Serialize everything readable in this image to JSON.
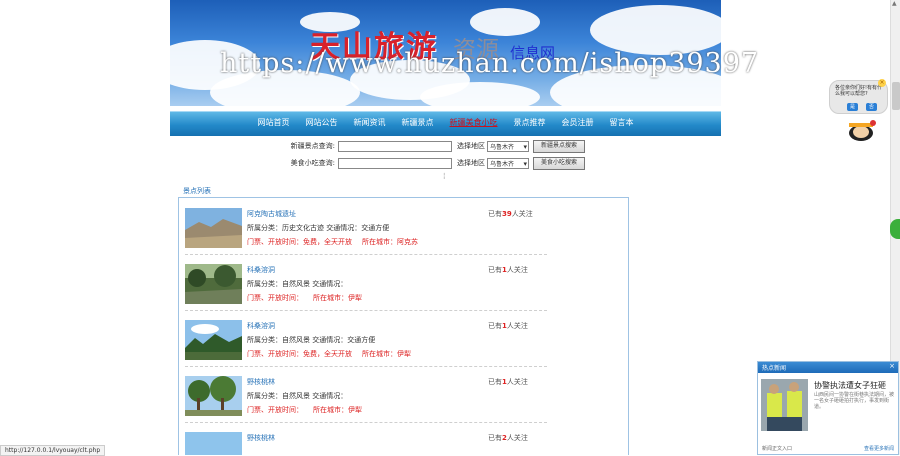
{
  "banner": {
    "logo_red": "天山旅游",
    "logo_grey": "资源",
    "logo_blue": "信息网",
    "watermark": "https://www.huzhan.com/ishop39397"
  },
  "nav": {
    "items": [
      {
        "label": "网站首页"
      },
      {
        "label": "网站公告"
      },
      {
        "label": "新闻资讯"
      },
      {
        "label": "新疆景点"
      },
      {
        "label": "新疆美食小吃"
      },
      {
        "label": "景点推荐"
      },
      {
        "label": "会员注册"
      },
      {
        "label": "留言本"
      }
    ],
    "active_index": 4
  },
  "search": {
    "scenic": {
      "label": "新疆景点查询:",
      "region_label": "选择地区",
      "region_value": "乌鲁木齐",
      "button": "新疆景点搜索"
    },
    "food": {
      "label": "美食小吃查询:",
      "region_label": "选择地区",
      "region_value": "乌鲁木齐",
      "button": "美食小吃搜索"
    }
  },
  "list": {
    "header": "景点列表",
    "items": [
      {
        "name": "阿克陶古城遗址",
        "meta": "所属分类：历史文化古迹  交通情况：交通方便",
        "ticket": "门票、开放时间：免费，全天开放",
        "city": "所在城市：阿克苏",
        "follow_prefix": "已有",
        "follow_count": "39",
        "follow_suffix": "人关注"
      },
      {
        "name": "科桑溶洞",
        "meta": "所属分类：自然风景  交通情况：",
        "ticket": "门票、开放时间：",
        "city": "所在城市：伊犁",
        "follow_prefix": "已有",
        "follow_count": "1",
        "follow_suffix": "人关注"
      },
      {
        "name": "科桑溶洞",
        "meta": "所属分类：自然风景  交通情况：交通方便",
        "ticket": "门票、开放时间：免费，全天开放",
        "city": "所在城市：伊犁",
        "follow_prefix": "已有",
        "follow_count": "1",
        "follow_suffix": "人关注"
      },
      {
        "name": "野核桃林",
        "meta": "所属分类：自然风景  交通情况：",
        "ticket": "门票、开放时间：",
        "city": "所在城市：伊犁",
        "follow_prefix": "已有",
        "follow_count": "1",
        "follow_suffix": "人关注"
      },
      {
        "name": "野核桃林",
        "meta": "",
        "ticket": "",
        "city": "",
        "follow_prefix": "已有",
        "follow_count": "2",
        "follow_suffix": "人关注"
      }
    ]
  },
  "chat_widget": {
    "bubble_text": "各位亲你们好!有有什么我可以帮您?",
    "yes_label": "是",
    "no_label": "否"
  },
  "news_popup": {
    "title": "热点新闻",
    "close": "×",
    "headline": "协警执法遭女子狂砸",
    "summary": "山西民间一协警在街巷执法期间，被一名女子砸砸拍打执行，事发到街道。",
    "footer_left": "新闻正文入口",
    "footer_right": "查看更多新闻"
  },
  "status_bar": {
    "url": "http://127.0.0.1/lvyouay/clt.php"
  },
  "colors": {
    "nav_blue": "#2389c9",
    "link_blue": "#2a74b8",
    "alert_red": "#d22222"
  }
}
